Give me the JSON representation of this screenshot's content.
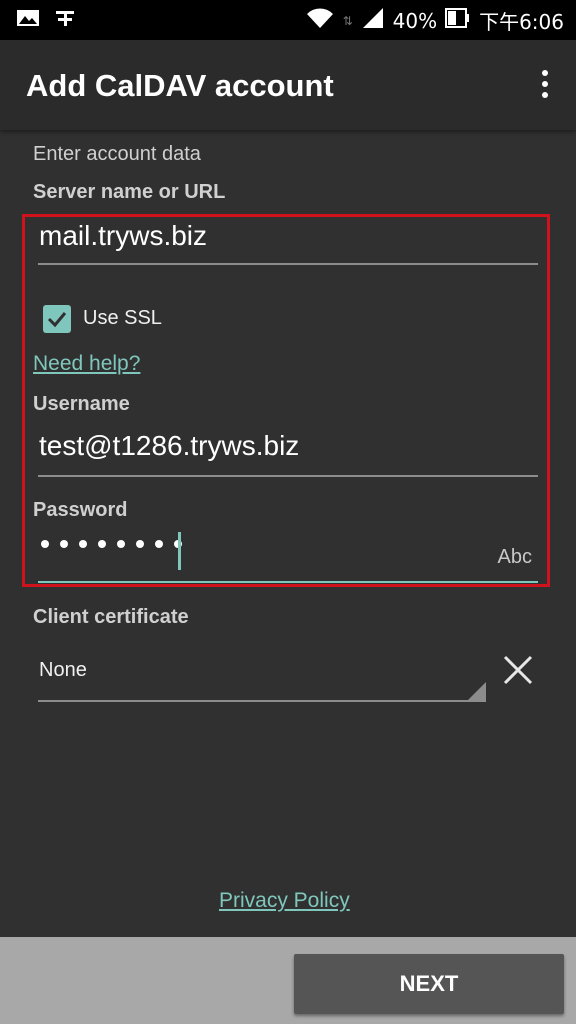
{
  "status_bar": {
    "battery": "40%",
    "time": "下午6:06",
    "icons": [
      "gallery-icon",
      "scale-icon",
      "wifi-icon",
      "signal-icon",
      "battery-icon"
    ]
  },
  "appbar": {
    "title": "Add CalDAV account",
    "menu_icon": "overflow-menu-icon"
  },
  "form": {
    "section_hint": "Enter account data",
    "server_label": "Server name or URL",
    "server_value": "mail.tryws.biz",
    "use_ssl_label": "Use SSL",
    "use_ssl_checked": true,
    "help_link": "Need help?",
    "username_label": "Username",
    "username_value": "test@t1286.tryws.biz",
    "password_label": "Password",
    "password_masked_length": 8,
    "keyboard_mode": "Abc",
    "client_cert_label": "Client certificate",
    "client_cert_value": "None"
  },
  "privacy_link": "Privacy Policy",
  "next_button": "NEXT",
  "colors": {
    "accent": "#7fc7bd",
    "highlight": "#d0121c",
    "background": "#303030"
  }
}
